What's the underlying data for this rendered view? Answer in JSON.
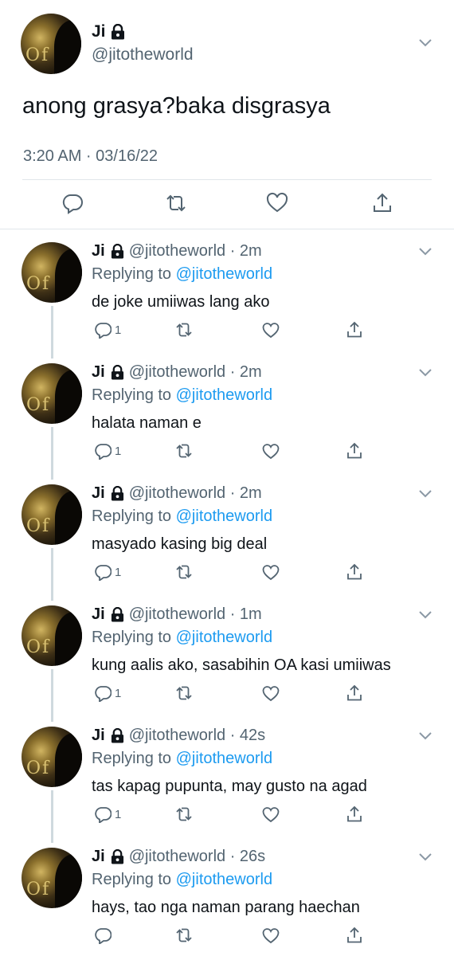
{
  "main_tweet": {
    "name": "Ji",
    "handle": "@jitotheworld",
    "text": "anong grasya?baka disgrasya",
    "meta": "3:20 AM · 03/16/22",
    "avatar_letters": "Of",
    "icons": [
      "lock-icon",
      "chevron-down-icon",
      "reply-icon",
      "retweet-icon",
      "like-icon",
      "share-icon"
    ]
  },
  "replies": [
    {
      "name": "Ji",
      "handle_time": "@jitotheworld · 2m",
      "replying_label": "Replying to",
      "mention": "@jitotheworld",
      "text": "de joke umiiwas lang ako",
      "reply_count": "1"
    },
    {
      "name": "Ji",
      "handle_time": "@jitotheworld · 2m",
      "replying_label": "Replying to",
      "mention": "@jitotheworld",
      "text": "halata naman e",
      "reply_count": "1"
    },
    {
      "name": "Ji",
      "handle_time": "@jitotheworld · 2m",
      "replying_label": "Replying to",
      "mention": "@jitotheworld",
      "text": "masyado kasing big deal",
      "reply_count": "1"
    },
    {
      "name": "Ji",
      "handle_time": "@jitotheworld · 1m",
      "replying_label": "Replying to",
      "mention": "@jitotheworld",
      "text": "kung aalis ako, sasabihin OA kasi umiiwas",
      "reply_count": "1"
    },
    {
      "name": "Ji",
      "handle_time": "@jitotheworld · 42s",
      "replying_label": "Replying to",
      "mention": "@jitotheworld",
      "text": "tas kapag pupunta, may gusto na agad",
      "reply_count": "1"
    },
    {
      "name": "Ji",
      "handle_time": "@jitotheworld · 26s",
      "replying_label": "Replying to",
      "mention": "@jitotheworld",
      "text": "hays, tao nga naman parang haechan",
      "reply_count": ""
    }
  ],
  "colors": {
    "text": "#0f1419",
    "secondary": "#536471",
    "accent": "#1d9bf0",
    "divider": "#e1e6ea",
    "thread_line": "#cfd9de"
  }
}
